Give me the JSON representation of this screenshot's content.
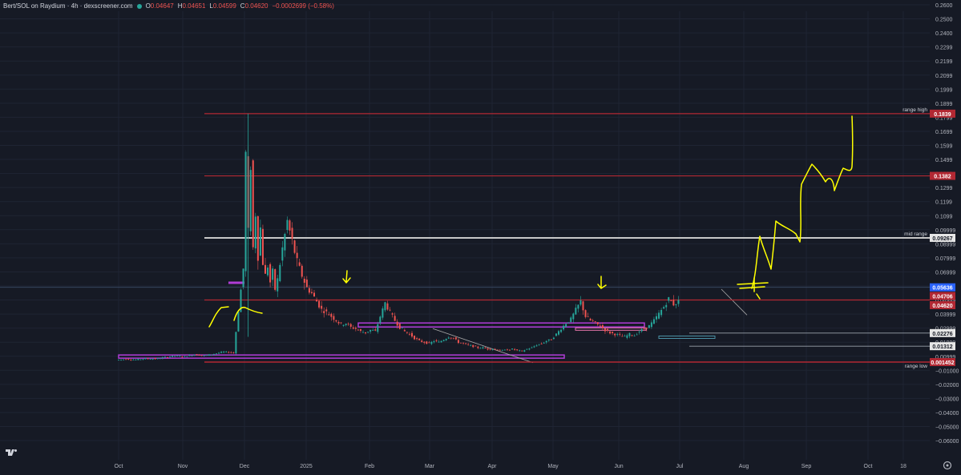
{
  "header": {
    "symbol_title": "Bert/SOL on Raydium · 4h · dexscreener.com",
    "open_label": "O",
    "open": "0.04647",
    "high_label": "H",
    "high": "0.04651",
    "low_label": "L",
    "low": "0.04599",
    "close_label": "C",
    "close": "0.04620",
    "change": "−0.0002699 (−0.58%)"
  },
  "colors": {
    "background": "#161a25",
    "candle_up": "#26a69a",
    "candle_down": "#ef5350",
    "resistance": "#b22833",
    "drawing": "#ffff00",
    "zone": "#b03cd6",
    "mid_line": "#c8c8c8"
  },
  "icons": [
    "tradingview-logo-icon",
    "settings-gear-icon",
    "currency-icon"
  ],
  "chart_data": {
    "type": "candlestick",
    "title": "",
    "x_ticks": [
      "Oct",
      "Nov",
      "Dec",
      "2025",
      "Feb",
      "Mar",
      "Apr",
      "May",
      "Jun",
      "Jul",
      "Aug",
      "Sep",
      "Oct",
      "18"
    ],
    "y_ticks": [
      "0.2600",
      "0.2500",
      "0.2400",
      "0.2299",
      "0.2199",
      "0.2099",
      "0.1999",
      "0.1899",
      "0.1799",
      "0.1699",
      "0.1599",
      "0.1499",
      "0.1399",
      "0.1299",
      "0.1199",
      "0.1099",
      "0.09999",
      "0.08999",
      "0.07999",
      "0.06999",
      "0.05999",
      "0.04999",
      "0.03999",
      "0.02999",
      "0.01999",
      "0.00999",
      "−0.01000",
      "−0.02000",
      "−0.03000",
      "−0.04000",
      "−0.05000",
      "−0.06000"
    ],
    "ylim": [
      -0.065,
      0.265
    ],
    "price_tags": [
      {
        "label": "0.1839",
        "value": 0.1839,
        "style": "red"
      },
      {
        "label": "0.1382",
        "value": 0.1382,
        "style": "red"
      },
      {
        "label": "0.09267",
        "value": 0.09267,
        "style": "white"
      },
      {
        "label": "0.05636",
        "value": 0.05636,
        "style": "blue"
      },
      {
        "label": "0.04706",
        "value": 0.04706,
        "style": "red"
      },
      {
        "label": "0.04620",
        "value": 0.0462,
        "style": "red"
      },
      {
        "label": "0.02276",
        "value": 0.02276,
        "style": "white"
      },
      {
        "label": "0.01312",
        "value": 0.01312,
        "style": "white"
      },
      {
        "label": "0.001452",
        "value": 0.001452,
        "style": "red"
      }
    ],
    "annotations": [
      {
        "text": "range high",
        "value": 0.1839
      },
      {
        "text": "mid range",
        "value": 0.09267
      },
      {
        "text": "range low",
        "value": 0.001452
      }
    ],
    "series": [
      {
        "values": [
          [
            0,
            0.003
          ],
          [
            4,
            0.0036
          ],
          [
            8,
            0.0032
          ],
          [
            12,
            0.004
          ],
          [
            16,
            0.0038
          ],
          [
            20,
            0.005
          ],
          [
            24,
            0.006
          ],
          [
            28,
            0.0055
          ],
          [
            32,
            0.007
          ],
          [
            36,
            0.0062
          ],
          [
            40,
            0.0074
          ],
          [
            44,
            0.009
          ],
          [
            48,
            0.0082
          ],
          [
            52,
            0.07
          ],
          [
            53,
            0.155
          ],
          [
            54,
            0.095
          ],
          [
            55,
            0.145
          ],
          [
            56,
            0.085
          ],
          [
            57,
            0.11
          ],
          [
            58,
            0.08
          ],
          [
            59,
            0.1
          ],
          [
            60,
            0.075
          ],
          [
            61,
            0.065
          ],
          [
            62,
            0.072
          ],
          [
            63,
            0.06
          ],
          [
            64,
            0.068
          ],
          [
            65,
            0.055
          ],
          [
            66,
            0.062
          ],
          [
            68,
            0.085
          ],
          [
            70,
            0.105
          ],
          [
            72,
            0.09
          ],
          [
            74,
            0.075
          ],
          [
            76,
            0.065
          ],
          [
            78,
            0.056
          ],
          [
            80,
            0.052
          ],
          [
            82,
            0.046
          ],
          [
            84,
            0.04
          ],
          [
            86,
            0.038
          ],
          [
            88,
            0.035
          ],
          [
            90,
            0.032
          ],
          [
            92,
            0.029
          ],
          [
            94,
            0.03
          ],
          [
            96,
            0.027
          ],
          [
            98,
            0.026
          ],
          [
            100,
            0.024
          ],
          [
            102,
            0.023
          ],
          [
            104,
            0.025
          ],
          [
            106,
            0.024
          ],
          [
            108,
            0.035
          ],
          [
            110,
            0.045
          ],
          [
            112,
            0.038
          ],
          [
            114,
            0.032
          ],
          [
            116,
            0.027
          ],
          [
            118,
            0.024
          ],
          [
            120,
            0.022
          ],
          [
            122,
            0.019
          ],
          [
            124,
            0.017
          ],
          [
            126,
            0.016
          ],
          [
            128,
            0.015
          ],
          [
            130,
            0.017
          ],
          [
            132,
            0.016
          ],
          [
            134,
            0.018
          ],
          [
            136,
            0.02
          ],
          [
            138,
            0.019
          ],
          [
            140,
            0.016
          ],
          [
            142,
            0.015
          ],
          [
            144,
            0.014
          ],
          [
            146,
            0.013
          ],
          [
            148,
            0.012
          ],
          [
            150,
            0.012
          ],
          [
            152,
            0.011
          ],
          [
            154,
            0.011
          ],
          [
            156,
            0.0105
          ],
          [
            158,
            0.01
          ],
          [
            160,
            0.0105
          ],
          [
            162,
            0.011
          ],
          [
            164,
            0.01
          ],
          [
            166,
            0.0095
          ],
          [
            168,
            0.011
          ],
          [
            170,
            0.012
          ],
          [
            172,
            0.014
          ],
          [
            174,
            0.015
          ],
          [
            176,
            0.017
          ],
          [
            178,
            0.018
          ],
          [
            180,
            0.022
          ],
          [
            182,
            0.026
          ],
          [
            184,
            0.03
          ],
          [
            186,
            0.033
          ],
          [
            188,
            0.04
          ],
          [
            190,
            0.046
          ],
          [
            192,
            0.035
          ],
          [
            194,
            0.032
          ],
          [
            196,
            0.03
          ],
          [
            198,
            0.028
          ],
          [
            200,
            0.025
          ],
          [
            202,
            0.023
          ],
          [
            204,
            0.022
          ],
          [
            206,
            0.021
          ],
          [
            208,
            0.02
          ],
          [
            210,
            0.022
          ],
          [
            212,
            0.021
          ],
          [
            214,
            0.024
          ],
          [
            216,
            0.026
          ],
          [
            218,
            0.028
          ],
          [
            220,
            0.032
          ],
          [
            222,
            0.037
          ],
          [
            224,
            0.042
          ],
          [
            226,
            0.048
          ],
          [
            228,
            0.044
          ],
          [
            230,
            0.046
          ]
        ]
      }
    ]
  }
}
